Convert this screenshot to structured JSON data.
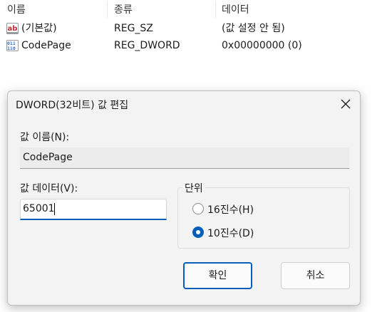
{
  "list": {
    "headers": {
      "name": "이름",
      "type": "종류",
      "data": "데이터"
    },
    "rows": [
      {
        "icon": "string-value-icon",
        "name": "(기본값)",
        "type": "REG_SZ",
        "data": "(값 설정 안 됨)"
      },
      {
        "icon": "binary-value-icon",
        "name": "CodePage",
        "type": "REG_DWORD",
        "data": "0x00000000 (0)"
      }
    ]
  },
  "dialog": {
    "title": "DWORD(32비트) 값 편집",
    "value_name_label": "값 이름(N):",
    "value_name": "CodePage",
    "value_data_label": "값 데이터(V):",
    "value_data": "65001",
    "base_group_label": "단위",
    "base_options": [
      {
        "label": "16진수(H)",
        "selected": false
      },
      {
        "label": "10진수(D)",
        "selected": true
      }
    ],
    "ok_label": "확인",
    "cancel_label": "취소"
  },
  "colors": {
    "accent": "#005fb8",
    "dialog_bg": "#f3f3f3",
    "string_icon_red": "#c8282e",
    "binary_icon_blue": "#2f6fcf"
  }
}
